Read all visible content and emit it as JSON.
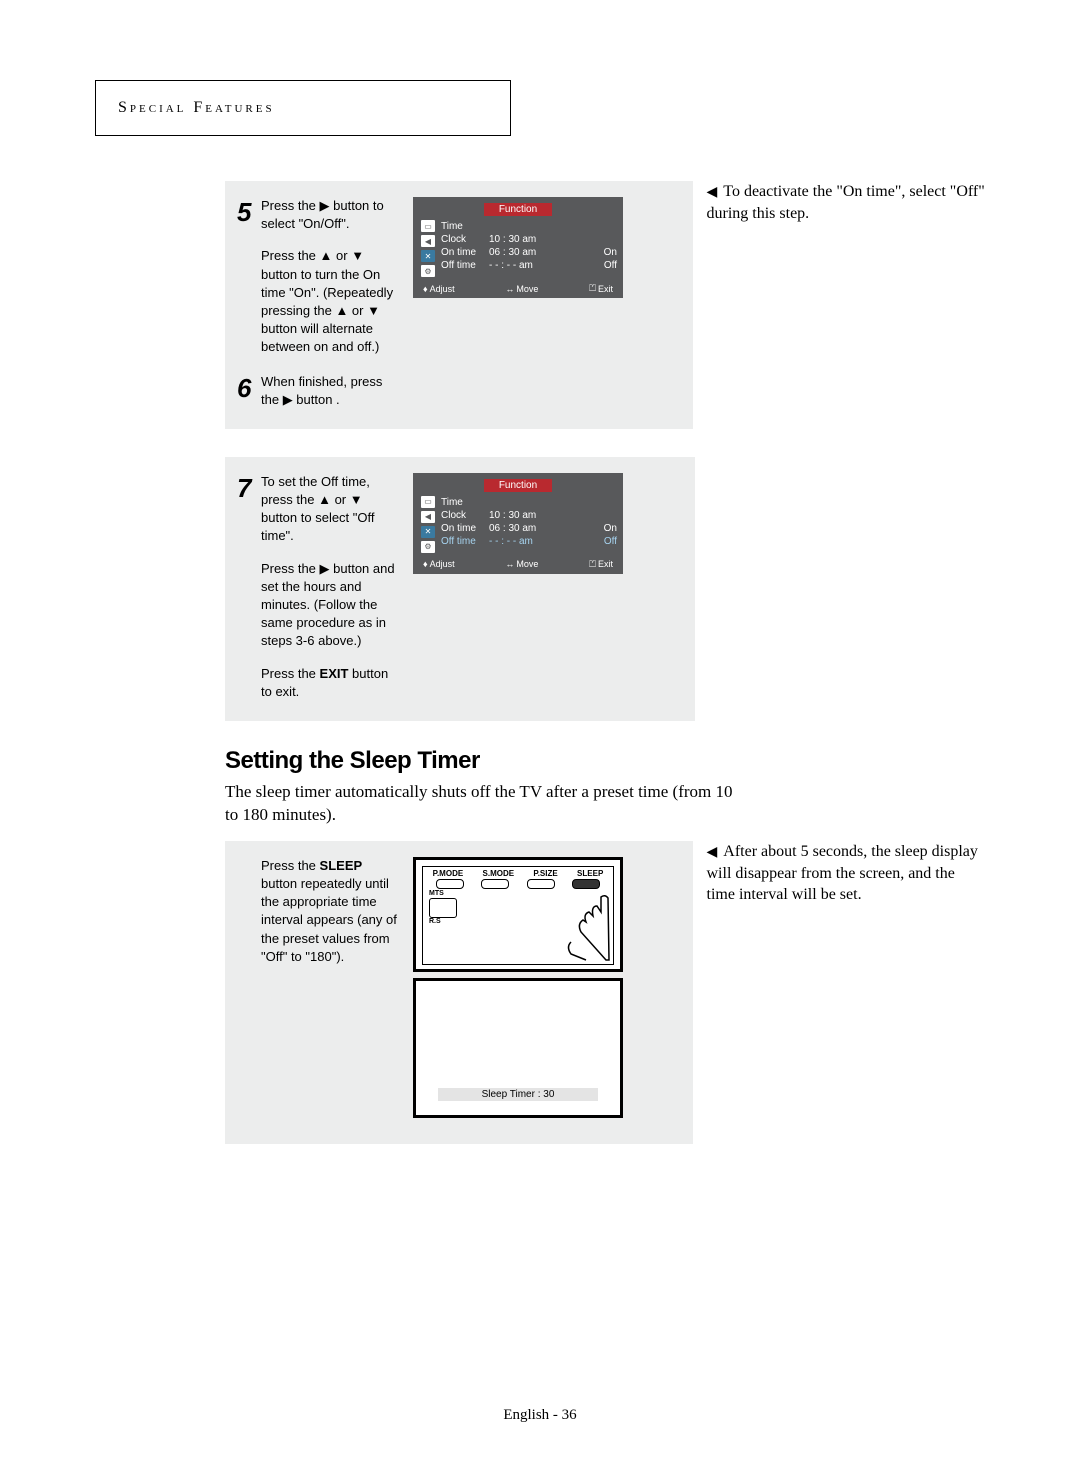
{
  "header": "Special Features",
  "steps": {
    "s5": {
      "num": "5",
      "p1_a": "Press the ",
      "p1_glyph": "▶",
      "p1_b": " button to select \"On/Off\".",
      "p2_a": "Press the ",
      "p2_g1": "▲",
      "p2_mid": " or ",
      "p2_g2": "▼",
      "p2_b": " button to turn the On time \"On\". (Repeatedly pressing the ",
      "p2_g3": "▲",
      "p2_mid2": " or ",
      "p2_g4": "▼",
      "p2_c": " button  will alternate between on and off.)"
    },
    "s6": {
      "num": "6",
      "p1_a": "When finished, press the ",
      "p1_glyph": "▶",
      "p1_b": " button ."
    },
    "s7": {
      "num": "7",
      "p1_a": "To set the Off time, press the ",
      "p1_g1": "▲",
      "p1_mid": " or ",
      "p1_g2": "▼",
      "p1_b": " button  to select \"Off time\".",
      "p2_a": "Press the ",
      "p2_glyph": "▶",
      "p2_b": " button and set the hours and minutes. (Follow the same procedure as in steps 3-6 above.)",
      "p3_a": "Press the ",
      "p3_bold": "EXIT",
      "p3_b": " button to exit."
    },
    "sleep": {
      "p1_a": "Press the ",
      "p1_bold": "SLEEP",
      "p1_b": " button repeatedly until the appropriate time interval appears (any of the preset values from \"Off\" to \"180\")."
    }
  },
  "osd": {
    "title": "Function",
    "rows": {
      "time": "Time",
      "clock_lbl": "Clock",
      "clock_val": "10 : 30 am",
      "on_lbl": "On time",
      "on_val": "06 : 30 am",
      "on_stat": "On",
      "off_lbl": "Off time",
      "off_val": "- -  :  - - am",
      "off_stat": "Off"
    },
    "foot": {
      "adjust": "Adjust",
      "move": "Move",
      "exit": "Exit"
    }
  },
  "remote": {
    "labels": [
      "P.MODE",
      "S.MODE",
      "P.SIZE",
      "SLEEP"
    ],
    "sub1": "MTS",
    "sub2": "R.S"
  },
  "sleep_bar": "Sleep Timer    :       30",
  "notes": {
    "n1": "To deactivate the \"On time\", select \"Off\" during this step.",
    "n2": "After about 5 seconds, the sleep display will disappear from the screen, and the time interval will be set."
  },
  "section": {
    "title": "Setting the Sleep Timer",
    "intro": "The sleep timer automatically shuts off the TV after a preset time (from 10 to 180 minutes)."
  },
  "footer": "English - 36"
}
